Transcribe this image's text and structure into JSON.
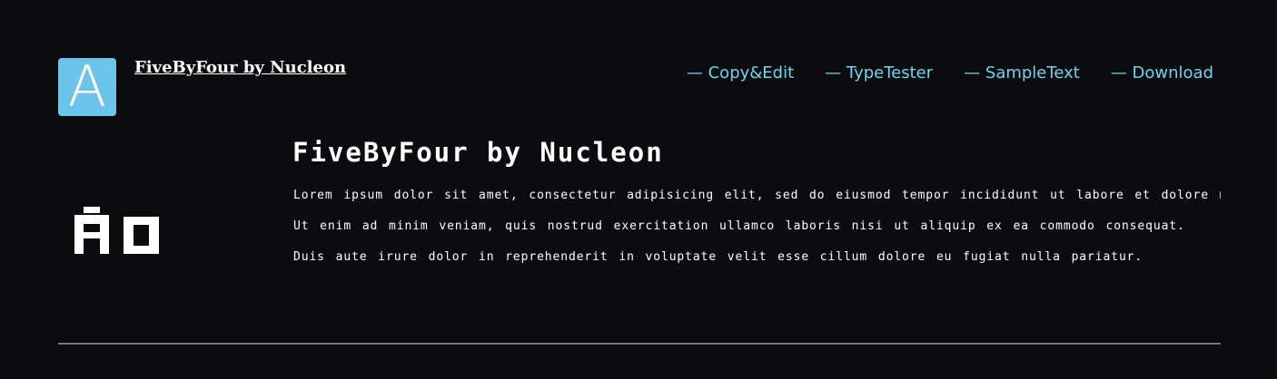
{
  "header": {
    "logo_letter": "A",
    "site_title": "FiveByFour by Nucleon",
    "nav": [
      {
        "label": "— Copy&Edit"
      },
      {
        "label": "— TypeTester"
      },
      {
        "label": "— SampleText"
      },
      {
        "label": "— Download"
      }
    ]
  },
  "preview": {
    "glyph_sample": "Aa",
    "font_name": "FiveByFour by Nucleon",
    "paragraphs": [
      "Lorem ipsum dolor sit amet, consectetur adipisicing elit, sed do eiusmod tempor incididunt ut labore et dolore magna aliqua.",
      "Ut enim ad minim veniam, quis nostrud exercitation ullamco laboris nisi ut aliquip ex ea commodo consequat.",
      "Duis aute irure dolor in reprehenderit in voluptate velit esse cillum dolore eu fugiat nulla pariatur."
    ]
  },
  "colors": {
    "background": "#0b0b10",
    "logo_background": "#6cc4ea",
    "nav_link": "#6fd6ee",
    "divider": "#777777"
  }
}
